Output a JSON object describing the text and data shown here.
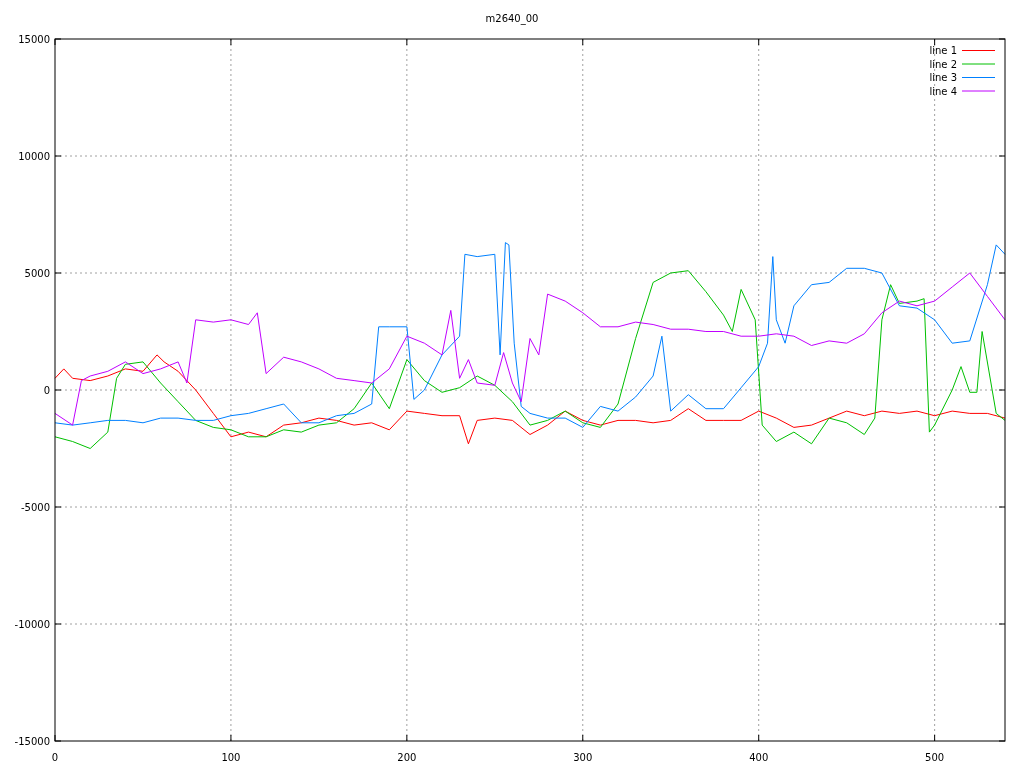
{
  "chart_data": {
    "type": "line",
    "title": "m2640_00",
    "xlim": [
      0,
      540
    ],
    "ylim": [
      -15000,
      15000
    ],
    "grid": true,
    "legend": true,
    "xticks": [
      0,
      100,
      200,
      300,
      400,
      500
    ],
    "yticks": [
      -15000,
      -10000,
      -5000,
      0,
      5000,
      10000,
      15000
    ],
    "series": [
      {
        "name": "line 1",
        "color": "#ff0000",
        "x": [
          0,
          5,
          10,
          20,
          30,
          40,
          50,
          58,
          62,
          70,
          80,
          90,
          100,
          110,
          120,
          130,
          140,
          150,
          160,
          170,
          180,
          190,
          200,
          210,
          220,
          230,
          235,
          240,
          250,
          260,
          270,
          280,
          290,
          300,
          310,
          320,
          330,
          340,
          350,
          360,
          370,
          380,
          390,
          400,
          410,
          420,
          430,
          440,
          450,
          460,
          470,
          480,
          490,
          500,
          510,
          520,
          530,
          540
        ],
        "values": [
          500,
          900,
          500,
          400,
          600,
          900,
          800,
          1500,
          1200,
          800,
          0,
          -1000,
          -2000,
          -1800,
          -2000,
          -1500,
          -1400,
          -1200,
          -1300,
          -1500,
          -1400,
          -1700,
          -900,
          -1000,
          -1100,
          -1100,
          -2300,
          -1300,
          -1200,
          -1300,
          -1900,
          -1500,
          -900,
          -1300,
          -1500,
          -1300,
          -1300,
          -1400,
          -1300,
          -800,
          -1300,
          -1300,
          -1300,
          -900,
          -1200,
          -1600,
          -1500,
          -1200,
          -900,
          -1100,
          -900,
          -1000,
          -900,
          -1100,
          -900,
          -1000,
          -1000,
          -1200
        ]
      },
      {
        "name": "line 2",
        "color": "#00c000",
        "x": [
          0,
          10,
          20,
          30,
          35,
          40,
          50,
          60,
          70,
          80,
          90,
          100,
          110,
          120,
          130,
          140,
          150,
          160,
          170,
          180,
          190,
          200,
          210,
          220,
          230,
          240,
          250,
          260,
          270,
          280,
          290,
          300,
          310,
          320,
          330,
          340,
          350,
          360,
          370,
          380,
          385,
          390,
          398,
          402,
          410,
          420,
          430,
          440,
          450,
          460,
          466,
          470,
          475,
          480,
          490,
          494,
          497,
          500,
          510,
          515,
          520,
          524,
          527,
          535,
          540
        ],
        "values": [
          -2000,
          -2200,
          -2500,
          -1800,
          500,
          1100,
          1200,
          300,
          -500,
          -1300,
          -1600,
          -1700,
          -2000,
          -2000,
          -1700,
          -1800,
          -1500,
          -1400,
          -800,
          300,
          -800,
          1300,
          400,
          -100,
          100,
          600,
          200,
          -500,
          -1500,
          -1300,
          -900,
          -1400,
          -1600,
          -600,
          2200,
          4600,
          5000,
          5100,
          4200,
          3200,
          2500,
          4300,
          3000,
          -1500,
          -2200,
          -1800,
          -2300,
          -1200,
          -1400,
          -1900,
          -1200,
          3000,
          4500,
          3700,
          3800,
          3900,
          -1800,
          -1500,
          0,
          1000,
          -100,
          -100,
          2500,
          -1000,
          -1300
        ]
      },
      {
        "name": "line 3",
        "color": "#0080ff",
        "x": [
          0,
          10,
          20,
          30,
          40,
          50,
          60,
          70,
          80,
          90,
          100,
          110,
          120,
          130,
          140,
          150,
          160,
          170,
          180,
          184,
          190,
          200,
          204,
          210,
          220,
          230,
          233,
          240,
          250,
          253,
          256,
          258,
          261,
          265,
          270,
          280,
          290,
          300,
          310,
          320,
          330,
          340,
          345,
          350,
          360,
          370,
          380,
          390,
          400,
          405,
          408,
          410,
          415,
          420,
          430,
          440,
          450,
          460,
          470,
          480,
          490,
          500,
          510,
          520,
          530,
          535,
          540
        ],
        "values": [
          -1400,
          -1500,
          -1400,
          -1300,
          -1300,
          -1400,
          -1200,
          -1200,
          -1300,
          -1300,
          -1100,
          -1000,
          -800,
          -600,
          -1400,
          -1400,
          -1100,
          -1000,
          -600,
          2700,
          2700,
          2700,
          -400,
          0,
          1500,
          2300,
          5800,
          5700,
          5800,
          1500,
          6300,
          6200,
          2000,
          -700,
          -1000,
          -1200,
          -1200,
          -1600,
          -700,
          -900,
          -300,
          600,
          2300,
          -900,
          -200,
          -800,
          -800,
          100,
          1000,
          2000,
          5700,
          3000,
          2000,
          3600,
          4500,
          4600,
          5200,
          5200,
          5000,
          3600,
          3500,
          3000,
          2000,
          2100,
          4500,
          6200,
          5800
        ]
      },
      {
        "name": "line 4",
        "color": "#c000ff",
        "x": [
          0,
          10,
          15,
          20,
          30,
          40,
          50,
          60,
          70,
          75,
          80,
          90,
          100,
          110,
          115,
          120,
          130,
          140,
          150,
          160,
          170,
          180,
          190,
          200,
          210,
          220,
          225,
          230,
          235,
          240,
          250,
          255,
          260,
          265,
          270,
          275,
          280,
          290,
          300,
          310,
          320,
          330,
          340,
          350,
          360,
          370,
          380,
          390,
          400,
          410,
          420,
          430,
          440,
          450,
          460,
          470,
          480,
          490,
          500,
          510,
          520,
          530,
          540
        ],
        "values": [
          -1000,
          -1500,
          400,
          600,
          800,
          1200,
          700,
          900,
          1200,
          300,
          3000,
          2900,
          3000,
          2800,
          3300,
          700,
          1400,
          1200,
          900,
          500,
          400,
          300,
          900,
          2300,
          2000,
          1500,
          3400,
          500,
          1300,
          300,
          200,
          1600,
          300,
          -500,
          2200,
          1500,
          4100,
          3800,
          3300,
          2700,
          2700,
          2900,
          2800,
          2600,
          2600,
          2500,
          2500,
          2300,
          2300,
          2400,
          2300,
          1900,
          2100,
          2000,
          2400,
          3300,
          3800,
          3600,
          3800,
          4400,
          5000,
          4000,
          3000
        ]
      }
    ]
  }
}
